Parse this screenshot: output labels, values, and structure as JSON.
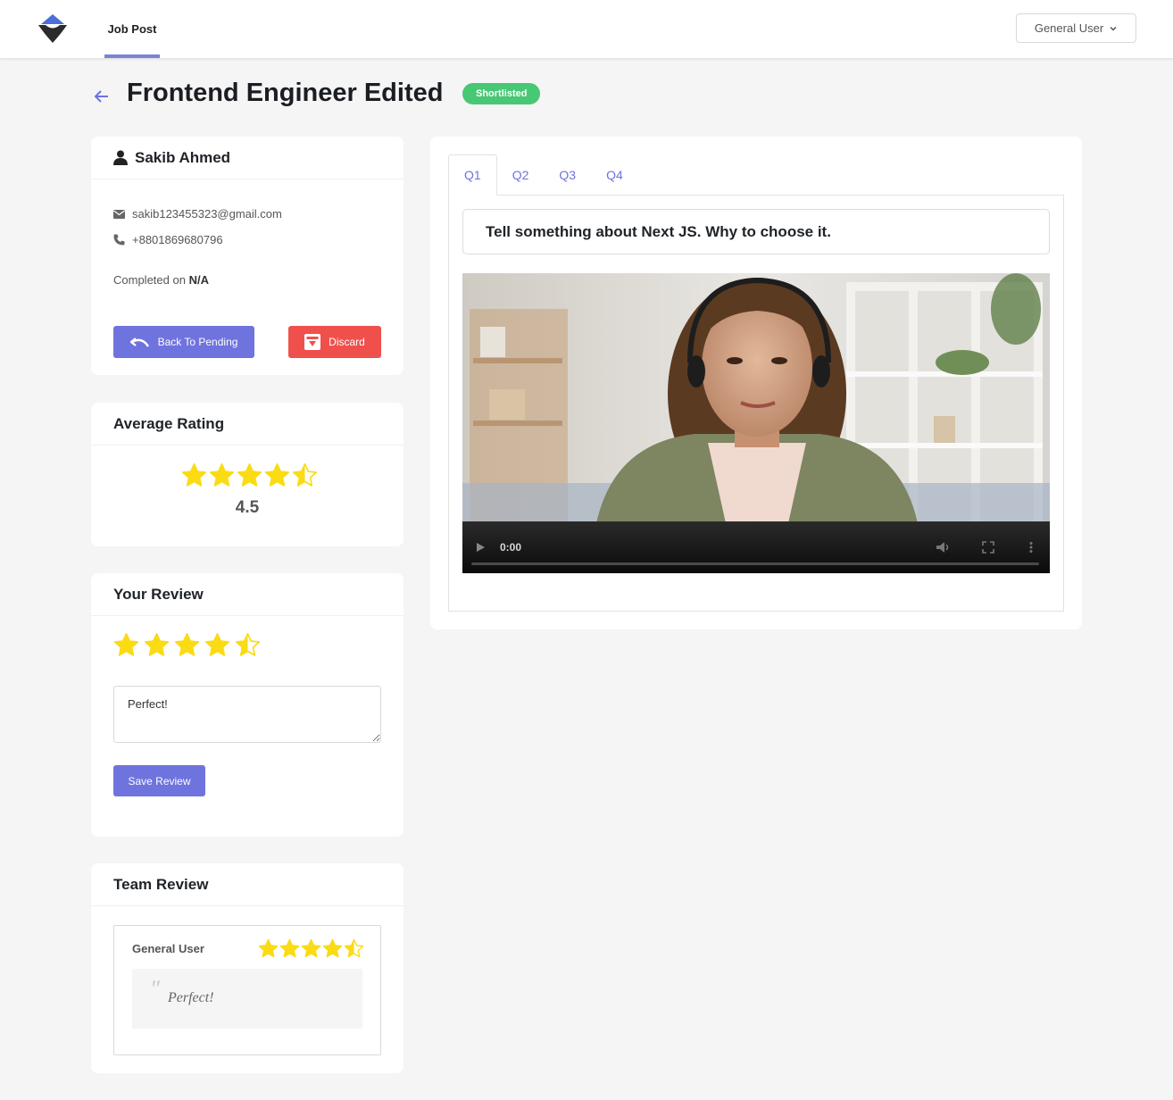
{
  "nav": {
    "job_post_label": "Job Post",
    "user_menu_label": "General User",
    "accent_color": "#7b82d6"
  },
  "page": {
    "title": "Frontend Engineer Edited",
    "status": "Shortlisted",
    "status_color": "#48c774"
  },
  "candidate": {
    "name": "Sakib Ahmed",
    "email": "sakib123455323@gmail.com",
    "phone": "+8801869680796",
    "completed_label": "Completed on",
    "completed_value": "N/A",
    "back_to_pending_label": "Back To Pending",
    "discard_label": "Discard"
  },
  "average_rating": {
    "title": "Average Rating",
    "value": "4.5",
    "stars": 4.5
  },
  "your_review": {
    "title": "Your Review",
    "stars": 4.5,
    "text": "Perfect!",
    "save_label": "Save Review"
  },
  "team_review": {
    "title": "Team Review",
    "reviews": [
      {
        "reviewer": "General User",
        "stars": 4.5,
        "comment": "Perfect!"
      }
    ]
  },
  "questions": {
    "tabs": [
      "Q1",
      "Q2",
      "Q3",
      "Q4"
    ],
    "active_tab": "Q1",
    "question_text": "Tell something about Next JS. Why to choose it.",
    "video_time": "0:00"
  }
}
